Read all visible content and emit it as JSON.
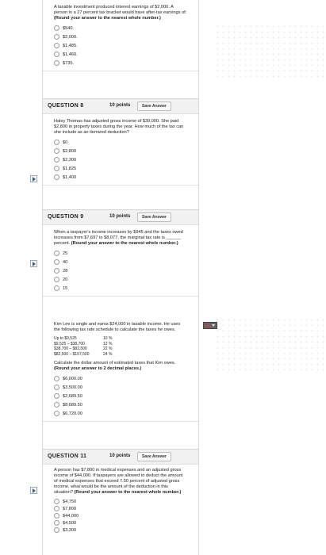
{
  "q7": {
    "text_1": "A taxable investment produced interest earnings of $2,000. A person in a 27 percent tax bracket would have after-tax earnings of: ",
    "text_bold": "(Round your answer to the nearest whole number.)",
    "options": [
      "$540.",
      "$2,000.",
      "$1,485.",
      "$1,460.",
      "$735."
    ]
  },
  "q8": {
    "label": "QUESTION 8",
    "points": "10 points",
    "save": "Save Answer",
    "text": "Haley Thomas has adjusted gross income of $39,000. She paid $2,800 in property taxes during the year. How much of the tax can she include as an itemized deduction?",
    "options": [
      "$0",
      "$2,800",
      "$2,300",
      "$1,825",
      "$1,400"
    ]
  },
  "q9": {
    "label": "QUESTION 9",
    "points": "10 points",
    "save": "Save Answer",
    "text_1": "When a taxpayer's income increases by $945 and the taxes owed increases from $7,697 to $8,077, the marginal tax rate is ______ percent. ",
    "text_bold": "(Round your answer to the nearest whole number.)",
    "options": [
      "25",
      "40",
      "28",
      "20",
      "15"
    ]
  },
  "q10": {
    "text": "Kim Lee is single and earns $24,000 in taxable income. He uses the following tax rate schedule to calculate the taxes he owes.",
    "table": [
      {
        "range": "Up to $9,525",
        "rate": "10 %"
      },
      {
        "range": "$9,525 – $38,700",
        "rate": "12 %"
      },
      {
        "range": "$38,700 – $82,500",
        "rate": "22 %"
      },
      {
        "range": "$82,500 – $157,500",
        "rate": "24 %"
      }
    ],
    "text_2": "Calculate the dollar amount of estimated taxes that Kim owes. ",
    "text_bold": "(Round your answer to 2 decimal places.)",
    "options": [
      "$6,000.00",
      "$3,500.00",
      "$2,689.50",
      "$8,689.50",
      "$6,720.00"
    ]
  },
  "q11": {
    "label": "QUESTION 11",
    "points": "10 points",
    "save": "Save Answer",
    "text_1": "A person has $7,800 in medical expenses and an adjusted gross income of $44,000. If taxpayers are allowed to deduct the amount of medical expenses that exceed 7.50 percent of adjusted gross income, what would be the amount of the deduction in this situation? ",
    "text_bold": "(Round your answer to the nearest whole number.)",
    "options": [
      "$4,750",
      "$7,800",
      "$44,000",
      "$4,500",
      "$3,300"
    ]
  },
  "colors": {
    "accent": "#2c5da8",
    "header_bg": "#f1f1f1"
  }
}
